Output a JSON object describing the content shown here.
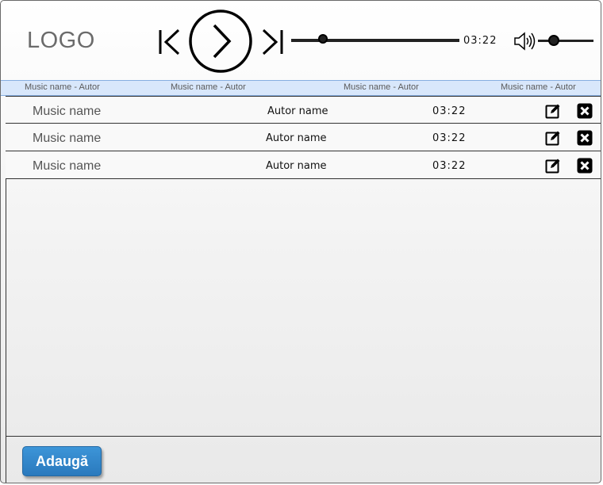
{
  "header": {
    "logo": "LOGO",
    "current_time": "03:22",
    "progress": 0.19,
    "volume": 0.29
  },
  "columns": [
    "Music name - Autor",
    "Music name - Autor",
    "Music name - Autor",
    "Music name - Autor"
  ],
  "tracks": [
    {
      "name": "Music name",
      "author": "Autor name",
      "duration": "03:22"
    },
    {
      "name": "Music name",
      "author": "Autor name",
      "duration": "03:22"
    },
    {
      "name": "Music name",
      "author": "Autor name",
      "duration": "03:22"
    }
  ],
  "icons": {
    "previous": "skip-previous-icon",
    "play": "play-icon",
    "next": "skip-next-icon",
    "volume": "volume-icon",
    "edit": "edit-icon",
    "delete": "delete-icon"
  },
  "footer": {
    "add_label": "Adaugă"
  },
  "colors": {
    "accent": "#2f86cc",
    "header_bar": "#d8e7fb"
  }
}
